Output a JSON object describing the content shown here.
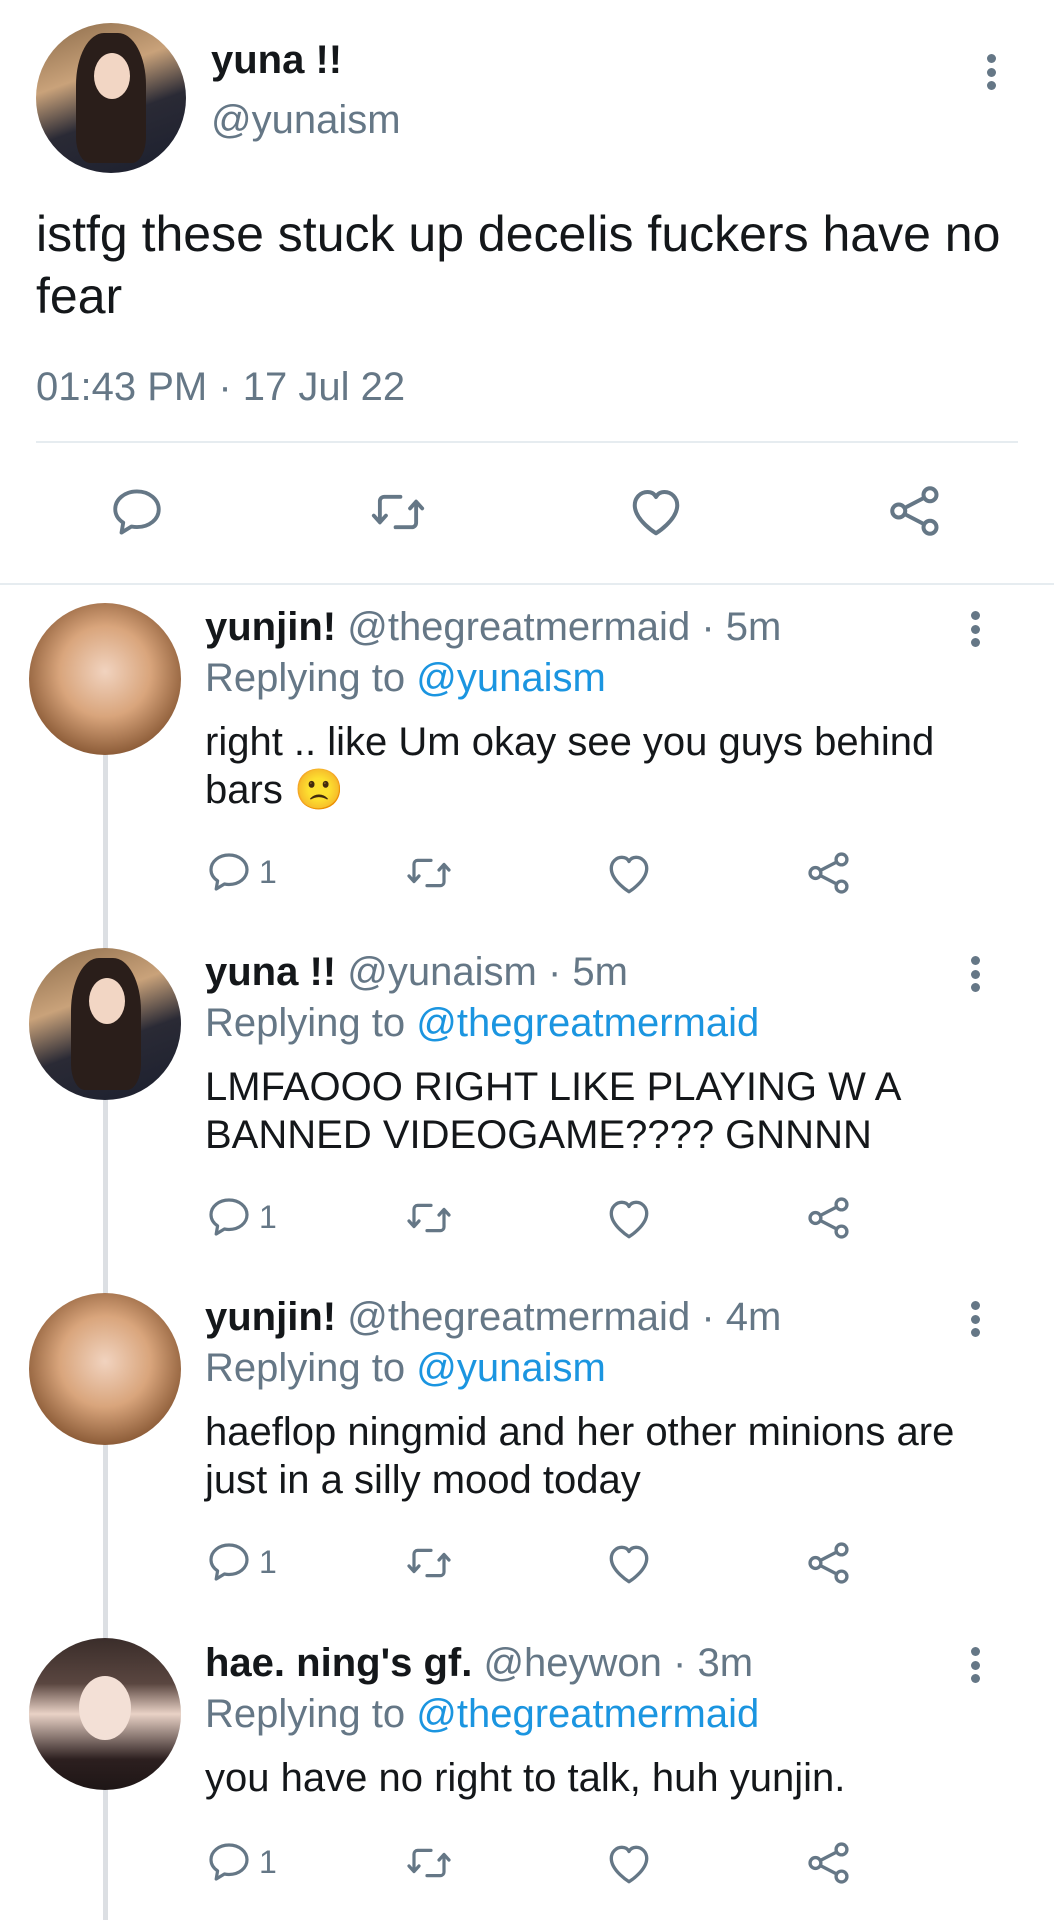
{
  "main_tweet": {
    "display_name": "yuna !!",
    "handle": "@yunaism",
    "text": "istfg these stuck up decelis fuckers have no fear",
    "time": "01:43 PM",
    "date": "17 Jul 22",
    "separator": "·"
  },
  "replying_label": "Replying to",
  "replies": [
    {
      "display_name": "yunjin!",
      "handle": "@thegreatmermaid",
      "time": "· 5m",
      "replying_to": "@yunaism",
      "text": "right .. like Um okay see you guys behind bars",
      "emoji": "🙁",
      "reply_count": "1"
    },
    {
      "display_name": "yuna !!",
      "handle": "@yunaism",
      "time": "· 5m",
      "replying_to": "@thegreatmermaid",
      "text": "LMFAOOO RIGHT LIKE PLAYING W A BANNED VIDEOGAME???? GNNNN",
      "reply_count": "1"
    },
    {
      "display_name": "yunjin!",
      "handle": "@thegreatmermaid",
      "time": "· 4m",
      "replying_to": "@yunaism",
      "text": "haeflop ningmid and her other minions are just in a silly mood today",
      "reply_count": "1"
    },
    {
      "display_name": "hae. ning's gf.",
      "handle": "@heywon",
      "time": "· 3m",
      "replying_to": "@thegreatmermaid",
      "text": "you have no right to talk, huh yunjin.",
      "reply_count": "1"
    }
  ],
  "colors": {
    "text": "#14171a",
    "muted": "#657786",
    "link": "#1b95e0",
    "divider": "#e6ecf0"
  },
  "icons": [
    "reply-icon",
    "retweet-icon",
    "like-icon",
    "share-icon",
    "more-options-icon"
  ]
}
